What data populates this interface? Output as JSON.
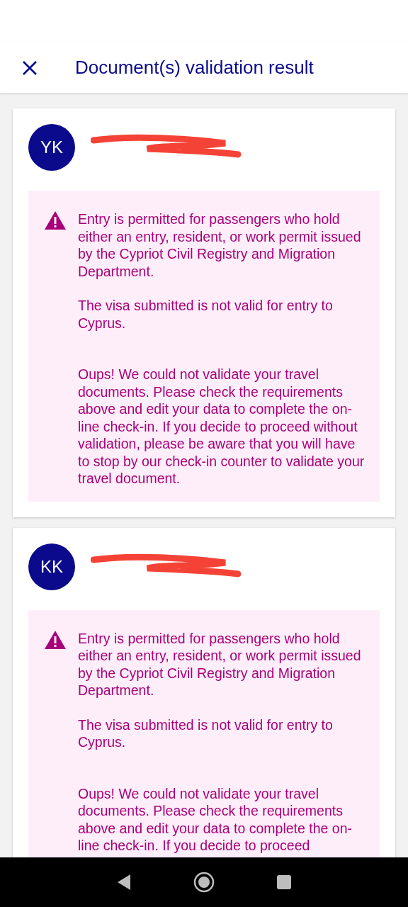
{
  "header": {
    "title": "Document(s) validation result"
  },
  "passengers": [
    {
      "initials": "YK",
      "messages": [
        "Entry is permitted for passengers who hold either an entry, resident, or work permit issued by the Cypriot Civil Registry and Migration Department.",
        "The visa submitted is not valid for entry to Cyprus.",
        "Oups! We could not validate your travel documents. Please check the requirements above and edit your data to complete the on-line check-in. If you decide to proceed without validation, please be aware that you will have to stop by our check-in counter to validate your travel document."
      ]
    },
    {
      "initials": "KK",
      "messages": [
        "Entry is permitted for passengers who hold either an entry, resident, or work permit issued by the Cypriot Civil Registry and Migration Department.",
        "The visa submitted is not valid for entry to Cyprus.",
        "Oups! We could not validate your travel documents. Please check the requirements above and edit your data to complete the on-line check-in. If you decide to proceed"
      ]
    }
  ]
}
